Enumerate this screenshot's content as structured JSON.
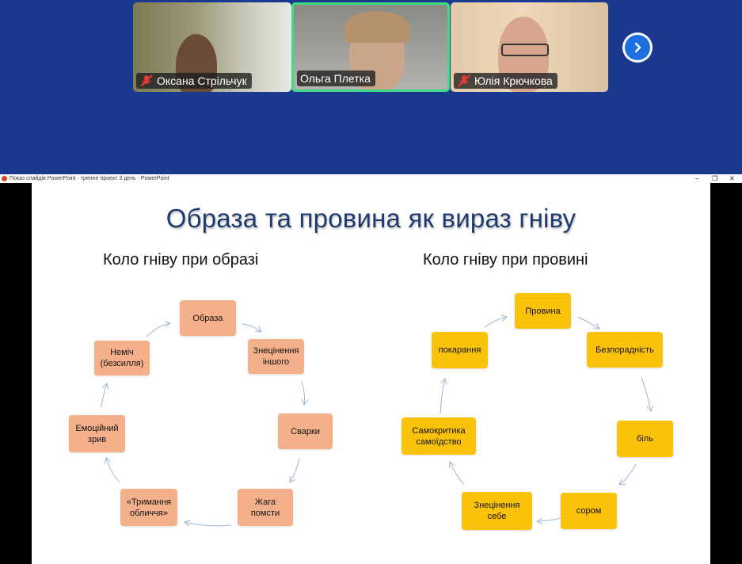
{
  "participants": [
    {
      "name": "Оксана Стрільчук",
      "muted": true
    },
    {
      "name": "Ольга Плетка",
      "muted": false
    },
    {
      "name": "Юлія Крючкова",
      "muted": true
    }
  ],
  "window": {
    "title": "Показ слайдів PowerPoint  -  тренінг проект 3 день  -  PowerPoint",
    "minimize": "‒",
    "restore": "❐",
    "close": "✕"
  },
  "slide": {
    "title": "Образа та провина як вираз гніву",
    "left_heading": "Коло гніву при образі",
    "right_heading": "Коло гніву при провині",
    "anger_cycle": [
      "Образа",
      "Знецінення\nіншого",
      "Сварки",
      "Жага\nпомсти",
      "«Тримання\nобличчя»",
      "Емоційний\nзрив",
      "Неміч\n(безсилля)"
    ],
    "guilt_cycle": [
      "Провина",
      "Безпорадність",
      "біль",
      "сором",
      "Знецінення\nсебе",
      "Самокритика\nсамоїдство",
      "покарання"
    ]
  },
  "colors": {
    "video_bg": "#1b3a8f",
    "active_speaker_border": "#3ddc84",
    "peach_box": "#f4b08a",
    "yellow_box": "#fbc20a",
    "arrow": "#9fb6cf",
    "title_text": "#1f3a6e"
  }
}
